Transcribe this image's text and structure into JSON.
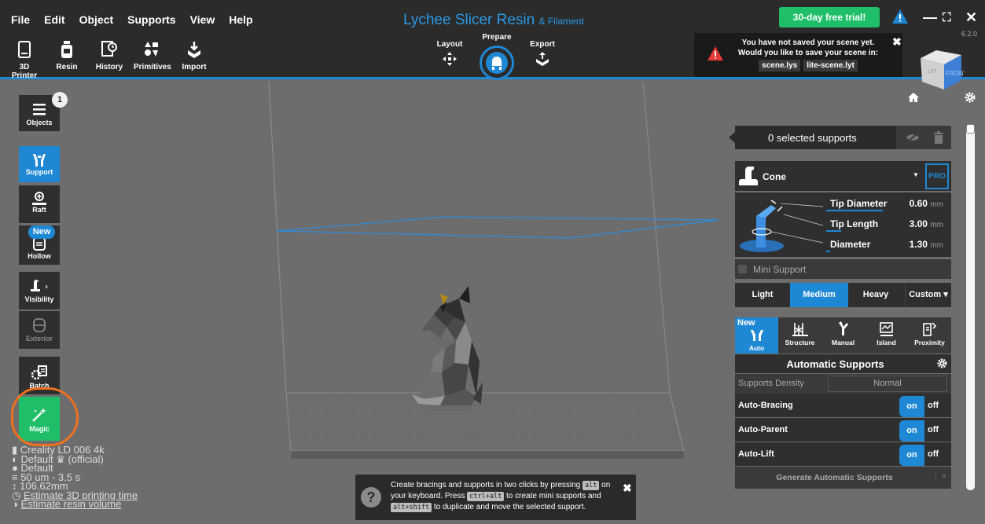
{
  "menu": [
    "File",
    "Edit",
    "Object",
    "Supports",
    "View",
    "Help"
  ],
  "app_title": "Lychee Slicer Resin",
  "app_title_suffix": "& Filament",
  "tools": [
    "3D Printer",
    "Resin",
    "History",
    "Primitives",
    "Import"
  ],
  "steps": {
    "layout": "Layout",
    "prepare": "Prepare",
    "export": "Export"
  },
  "trial_button": "30-day free trial!",
  "version": "6.2.0",
  "notice": {
    "text": "You have not saved your scene yet. Would you like to save your scene in:",
    "file1": "scene.lys",
    "file2": "lite-scene.lyt"
  },
  "cube": {
    "left": "LFT",
    "front": "FRONT"
  },
  "left_toolbar": {
    "objects": "Objects",
    "objects_count": "1",
    "support": "Support",
    "raft": "Raft",
    "hollow": "Hollow",
    "new_tag": "New",
    "visibility": "Visibility",
    "exterior": "Exterior",
    "batch": "Batch",
    "magic": "Magic"
  },
  "printer_info": {
    "printer": "Creality LD 006 4k",
    "resin": "Default ♛ (official)",
    "profile": "Default",
    "layer": "50 um - 3.5 s",
    "height": "106.62mm",
    "estimate_time": "Estimate 3D printing time",
    "estimate_resin": "Estimate resin volume"
  },
  "tip": {
    "part1": "Create bracings and supports in two clicks by pressing",
    "key1": "alt",
    "part2": "on your keyboard. Press",
    "key2": "ctrl+alt",
    "part3": "to create mini supports and",
    "key3": "alt+shift",
    "part4": "to duplicate and move the selected support."
  },
  "right_panel": {
    "selected": "0 selected supports",
    "support_type": "Cone",
    "pro": "PRO",
    "dims": [
      {
        "name": "Tip Diameter",
        "value": "0.60",
        "unit": "mm",
        "fill": 0.45
      },
      {
        "name": "Tip Length",
        "value": "3.00",
        "unit": "mm",
        "fill": 0.12
      },
      {
        "name": "Diameter",
        "value": "1.30",
        "unit": "mm",
        "fill": 0.03
      }
    ],
    "mini_support": "Mini Support",
    "density_options": [
      "Light",
      "Medium",
      "Heavy",
      "Custom ▾"
    ],
    "density_selected": "Medium",
    "modes": [
      "Auto",
      "Structure",
      "Manual",
      "Island",
      "Proximity"
    ],
    "mode_new": "New",
    "auto_title": "Automatic Supports",
    "supports_density_label": "Supports Density",
    "supports_density_value": "Normal",
    "toggles": [
      {
        "label": "Auto-Bracing",
        "on": "on",
        "off": "off"
      },
      {
        "label": "Auto-Parent",
        "on": "on",
        "off": "off"
      },
      {
        "label": "Auto-Lift",
        "on": "on",
        "off": "off"
      }
    ],
    "generate": "Generate Automatic Supports"
  },
  "colors": {
    "accent": "#1e88d4",
    "trial": "#1fbf6a",
    "magic": "#1fbf6a",
    "highlight": "#f07020",
    "bg": "#6d6d6d"
  }
}
